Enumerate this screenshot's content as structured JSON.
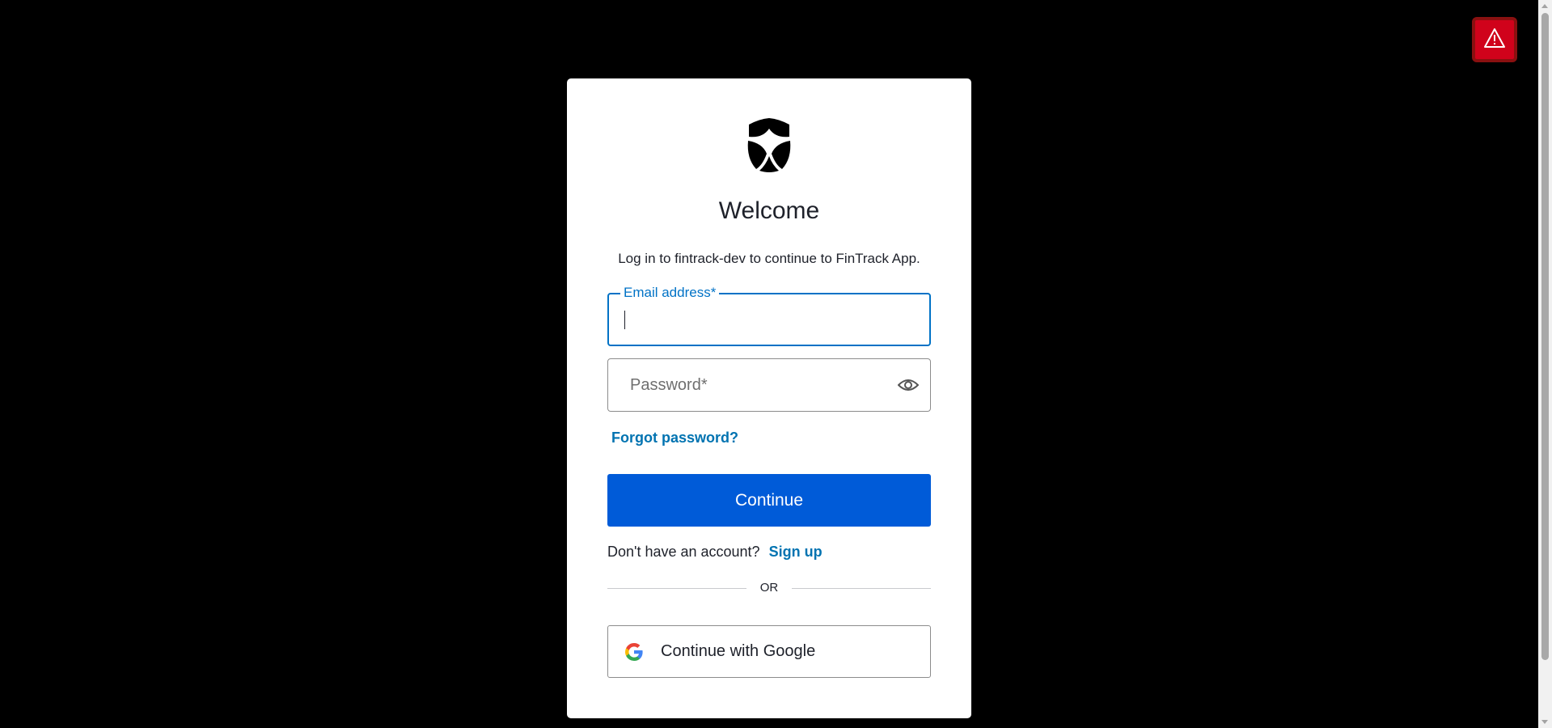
{
  "card": {
    "title": "Welcome",
    "subtitle": "Log in to fintrack-dev to continue to FinTrack App.",
    "logo_icon": "shield-star-icon"
  },
  "email": {
    "label": "Email address*",
    "value": ""
  },
  "password": {
    "placeholder": "Password*",
    "toggle_icon": "eye-icon"
  },
  "links": {
    "forgot_password": "Forgot password?",
    "no_account_text": "Don't have an account?",
    "sign_up": "Sign up"
  },
  "buttons": {
    "continue": "Continue",
    "google": "Continue with Google"
  },
  "divider": {
    "text": "OR"
  },
  "overlay": {
    "alert_icon": "warning-triangle-icon"
  },
  "colors": {
    "accent": "#0072c6",
    "primary_button": "#005bd8",
    "link": "#0073b1",
    "alert": "#d0021b",
    "background": "#000000"
  }
}
